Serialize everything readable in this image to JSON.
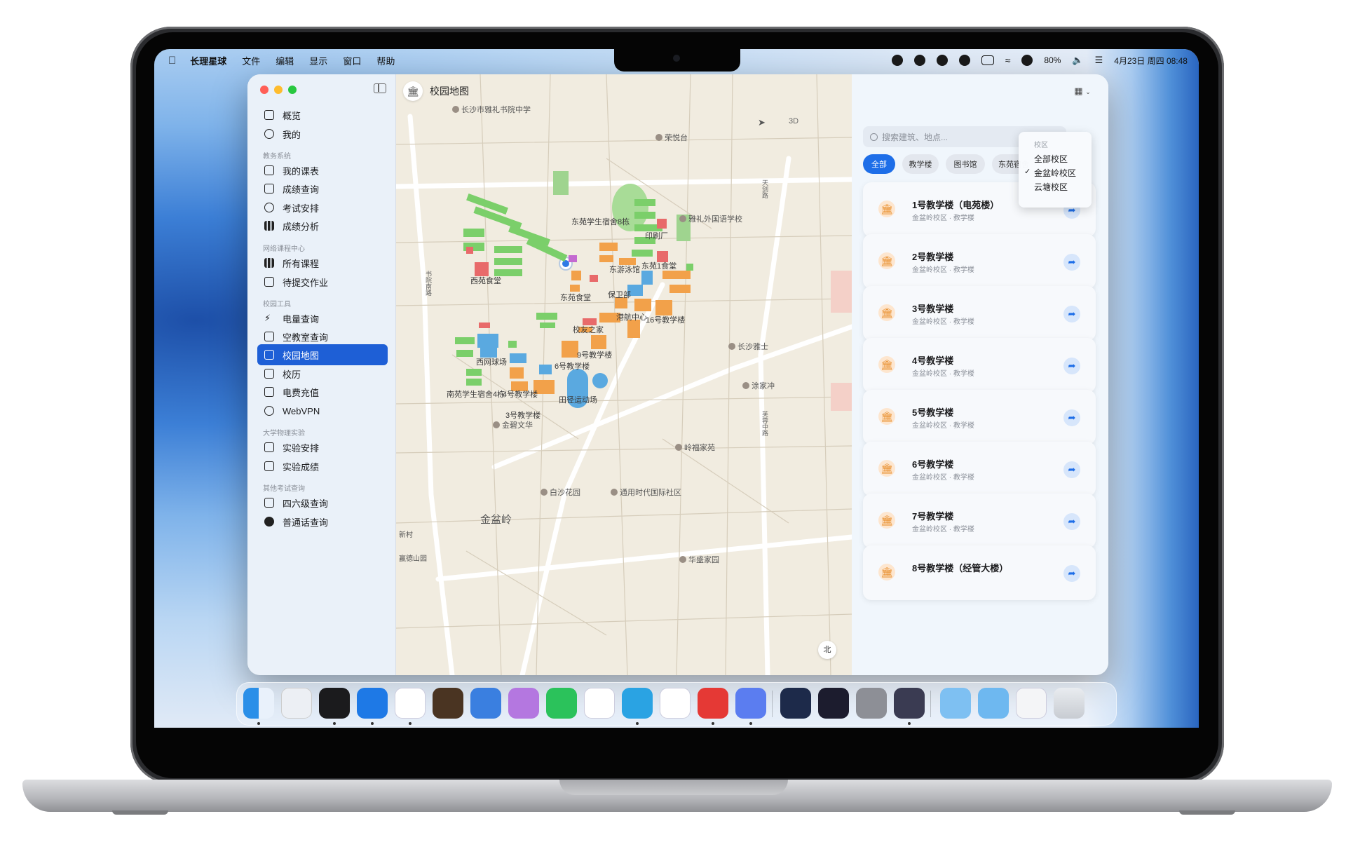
{
  "menubar": {
    "app_name": "长理星球",
    "menus": [
      "文件",
      "编辑",
      "显示",
      "窗口",
      "帮助"
    ],
    "battery": "80%",
    "datetime": "4月23日 周四 08:48"
  },
  "window": {
    "title": "校园地图"
  },
  "sidebar": {
    "top_items": [
      {
        "label": "概览",
        "icon": "overview-icon"
      },
      {
        "label": "我的",
        "icon": "person-icon"
      }
    ],
    "sections": [
      {
        "title": "教务系统",
        "items": [
          "我的课表",
          "成绩查询",
          "考试安排",
          "成绩分析"
        ]
      },
      {
        "title": "网络课程中心",
        "items": [
          "所有课程",
          "待提交作业"
        ]
      },
      {
        "title": "校园工具",
        "items": [
          "电量查询",
          "空教室查询",
          "校园地图",
          "校历",
          "电费充值",
          "WebVPN"
        ]
      },
      {
        "title": "大学物理实验",
        "items": [
          "实验安排",
          "实验成绩"
        ]
      },
      {
        "title": "其他考试查询",
        "items": [
          "四六级查询",
          "普通话查询"
        ]
      }
    ],
    "selected": "校园地图"
  },
  "map": {
    "control_3d": "3D",
    "compass": "北",
    "area_label": "金盆岭",
    "labels": [
      "东苑学生宿舍8栋",
      "印刷厂",
      "东游泳馆",
      "东苑1食堂",
      "西苑食堂",
      "东苑食堂",
      "保卫部",
      "港航中心",
      "16号教学楼",
      "校友之家",
      "9号教学楼",
      "西网球场",
      "6号教学楼",
      "南苑学生宿舍4栋",
      "4号教学楼",
      "田径运动场",
      "3号教学楼"
    ],
    "pois": [
      "长沙市雅礼书院中学",
      "荣悦台",
      "雅礼外国语学校",
      "长沙雅士",
      "涂家冲",
      "金碧文华",
      "岭福家苑",
      "白沙花园",
      "通用时代国际社区",
      "华盛家园"
    ],
    "roads": [
      "书院南路",
      "天剑路",
      "芙蓉中路",
      "新村",
      "赢德山园"
    ]
  },
  "panel": {
    "search_placeholder": "搜索建筑、地点...",
    "filters": [
      "全部",
      "教学楼",
      "图书馆",
      "东苑宿舍"
    ],
    "active_filter": "全部",
    "campus_dropdown": {
      "header": "校区",
      "options": [
        "全部校区",
        "金盆岭校区",
        "云塘校区"
      ],
      "checked": "金盆岭校区"
    },
    "buildings": [
      {
        "name": "1号教学楼（电苑楼）",
        "sub": "金盆岭校区 · 教学楼"
      },
      {
        "name": "2号教学楼",
        "sub": "金盆岭校区 · 教学楼"
      },
      {
        "name": "3号教学楼",
        "sub": "金盆岭校区 · 教学楼"
      },
      {
        "name": "4号教学楼",
        "sub": "金盆岭校区 · 教学楼"
      },
      {
        "name": "5号教学楼",
        "sub": "金盆岭校区 · 教学楼"
      },
      {
        "name": "6号教学楼",
        "sub": "金盆岭校区 · 教学楼"
      },
      {
        "name": "7号教学楼",
        "sub": "金盆岭校区 · 教学楼"
      },
      {
        "name": "8号教学楼（经管大楼）",
        "sub": ""
      }
    ]
  },
  "dock": {
    "apps": [
      "finder-icon",
      "launchpad-icon",
      "activity-icon",
      "xcode-icon",
      "vscode-icon",
      "terminal-icon",
      "fork-icon",
      "cat-icon",
      "wechat-icon",
      "qq-icon",
      "telegram-icon",
      "mail-icon",
      "netease-music-icon",
      "dev-icon",
      "kite-icon",
      "video-icon",
      "settings-icon",
      "app-icon",
      "folder-icon",
      "folder-icon",
      "preview-icon",
      "trash-icon"
    ]
  },
  "colors": {
    "accent": "#1e6ee8",
    "sidebar_selected": "#1e5fd6",
    "building_icon": "#e88a23"
  }
}
